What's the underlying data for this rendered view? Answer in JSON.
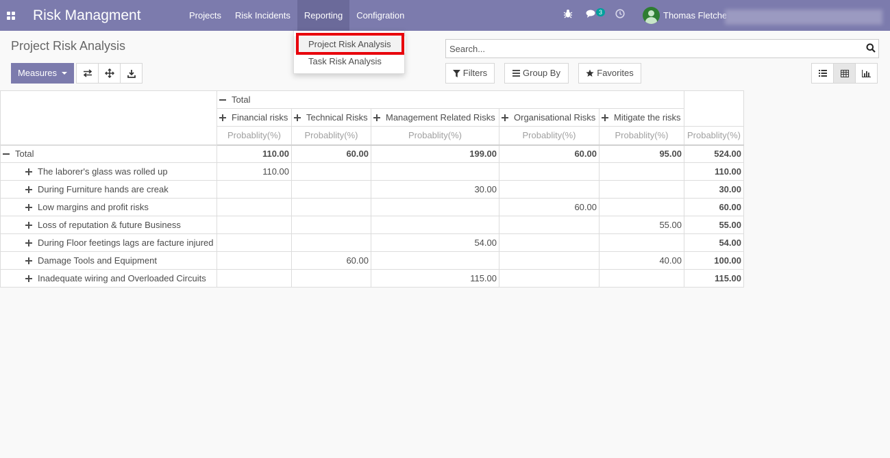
{
  "navbar": {
    "app_title": "Risk Managment",
    "menu": [
      "Projects",
      "Risk Incidents",
      "Reporting",
      "Configration"
    ],
    "active_menu": "Reporting",
    "chat_badge": "3",
    "user_name": "Thomas Fletcher",
    "icons": [
      "apps-icon",
      "bug-icon",
      "chat-icon",
      "clock-icon",
      "avatar"
    ]
  },
  "dropdown": {
    "items": [
      "Project Risk Analysis",
      "Task Risk Analysis"
    ],
    "highlighted": "Project Risk Analysis"
  },
  "control_panel": {
    "title": "Project Risk Analysis",
    "measures_label": "Measures",
    "search_placeholder": "Search...",
    "filters_label": "Filters",
    "groupby_label": "Group By",
    "favorites_label": "Favorites",
    "view_switcher": [
      "list-view",
      "pivot-view",
      "graph-view"
    ],
    "active_view": "pivot-view"
  },
  "pivot": {
    "col_total_label": "Total",
    "columns": [
      "Financial risks",
      "Technical Risks",
      "Management Related Risks",
      "Organisational Risks",
      "Mitigate the risks"
    ],
    "measure": "Probablity(%)",
    "total_row": {
      "label": "Total",
      "values": [
        "110.00",
        "60.00",
        "199.00",
        "60.00",
        "95.00"
      ],
      "total": "524.00"
    },
    "rows": [
      {
        "label": "The laborer's glass was rolled up",
        "values": [
          "110.00",
          "",
          "",
          "",
          ""
        ],
        "total": "110.00"
      },
      {
        "label": "During Furniture hands are creak",
        "values": [
          "",
          "",
          "30.00",
          "",
          ""
        ],
        "total": "30.00"
      },
      {
        "label": "Low margins and profit risks",
        "values": [
          "",
          "",
          "",
          "60.00",
          ""
        ],
        "total": "60.00"
      },
      {
        "label": "Loss of reputation & future Business",
        "values": [
          "",
          "",
          "",
          "",
          "55.00"
        ],
        "total": "55.00"
      },
      {
        "label": "During Floor feetings lags are facture injured",
        "values": [
          "",
          "",
          "54.00",
          "",
          ""
        ],
        "total": "54.00"
      },
      {
        "label": "Damage Tools and Equipment",
        "values": [
          "",
          "60.00",
          "",
          "",
          "40.00"
        ],
        "total": "100.00"
      },
      {
        "label": "Inadequate wiring and Overloaded Circuits",
        "values": [
          "",
          "",
          "115.00",
          "",
          ""
        ],
        "total": "115.00"
      }
    ]
  },
  "colors": {
    "navbar": "#7c7bad",
    "primary_button": "#7c7bad",
    "highlight_frame": "#e8000b",
    "badge": "#00a09d"
  }
}
